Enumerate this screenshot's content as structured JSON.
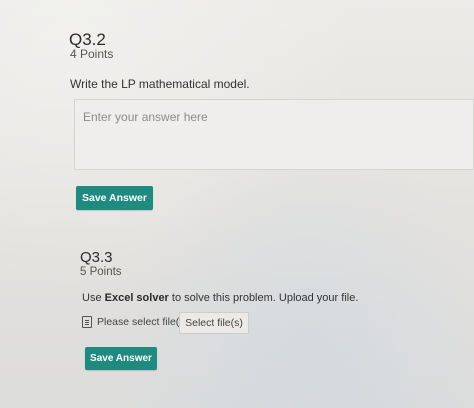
{
  "q32": {
    "title": "Q3.2",
    "points": "4 Points",
    "prompt": "Write the LP mathematical model.",
    "answer_placeholder": "Enter your answer here",
    "save_label": "Save Answer"
  },
  "q33": {
    "title": "Q3.3",
    "points": "5 Points",
    "prompt_prefix": "Use ",
    "prompt_bold": "Excel solver",
    "prompt_suffix": " to solve this problem. Upload your file.",
    "file_status": "Please select file(s)",
    "file_icon": "file-icon",
    "select_files_label": "Select file(s)",
    "save_label": "Save Answer"
  },
  "colors": {
    "accent": "#1f8a7f",
    "background": "#e7e5e2"
  }
}
